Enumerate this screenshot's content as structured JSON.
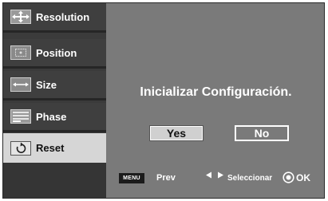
{
  "sidebar": {
    "items": [
      {
        "label": "Resolution",
        "icon": "resolution-icon",
        "active": false
      },
      {
        "label": "Position",
        "icon": "position-icon",
        "active": false
      },
      {
        "label": "Size",
        "icon": "size-icon",
        "active": false
      },
      {
        "label": "Phase",
        "icon": "phase-icon",
        "active": false
      },
      {
        "label": "Reset",
        "icon": "reset-icon",
        "active": true
      }
    ]
  },
  "dialog": {
    "message": "Inicializar Configuración.",
    "yes_label": "Yes",
    "no_label": "No",
    "focused_button": "Yes"
  },
  "footer": {
    "menu_key": "MENU",
    "prev_label": "Prev",
    "select_label": "Seleccionar",
    "ok_label": "OK"
  },
  "colors": {
    "panel_background": "#7a7a7a",
    "sidebar_background": "#3f3f3f",
    "active_item_background": "#d6d6d6",
    "text": "#ffffff"
  }
}
